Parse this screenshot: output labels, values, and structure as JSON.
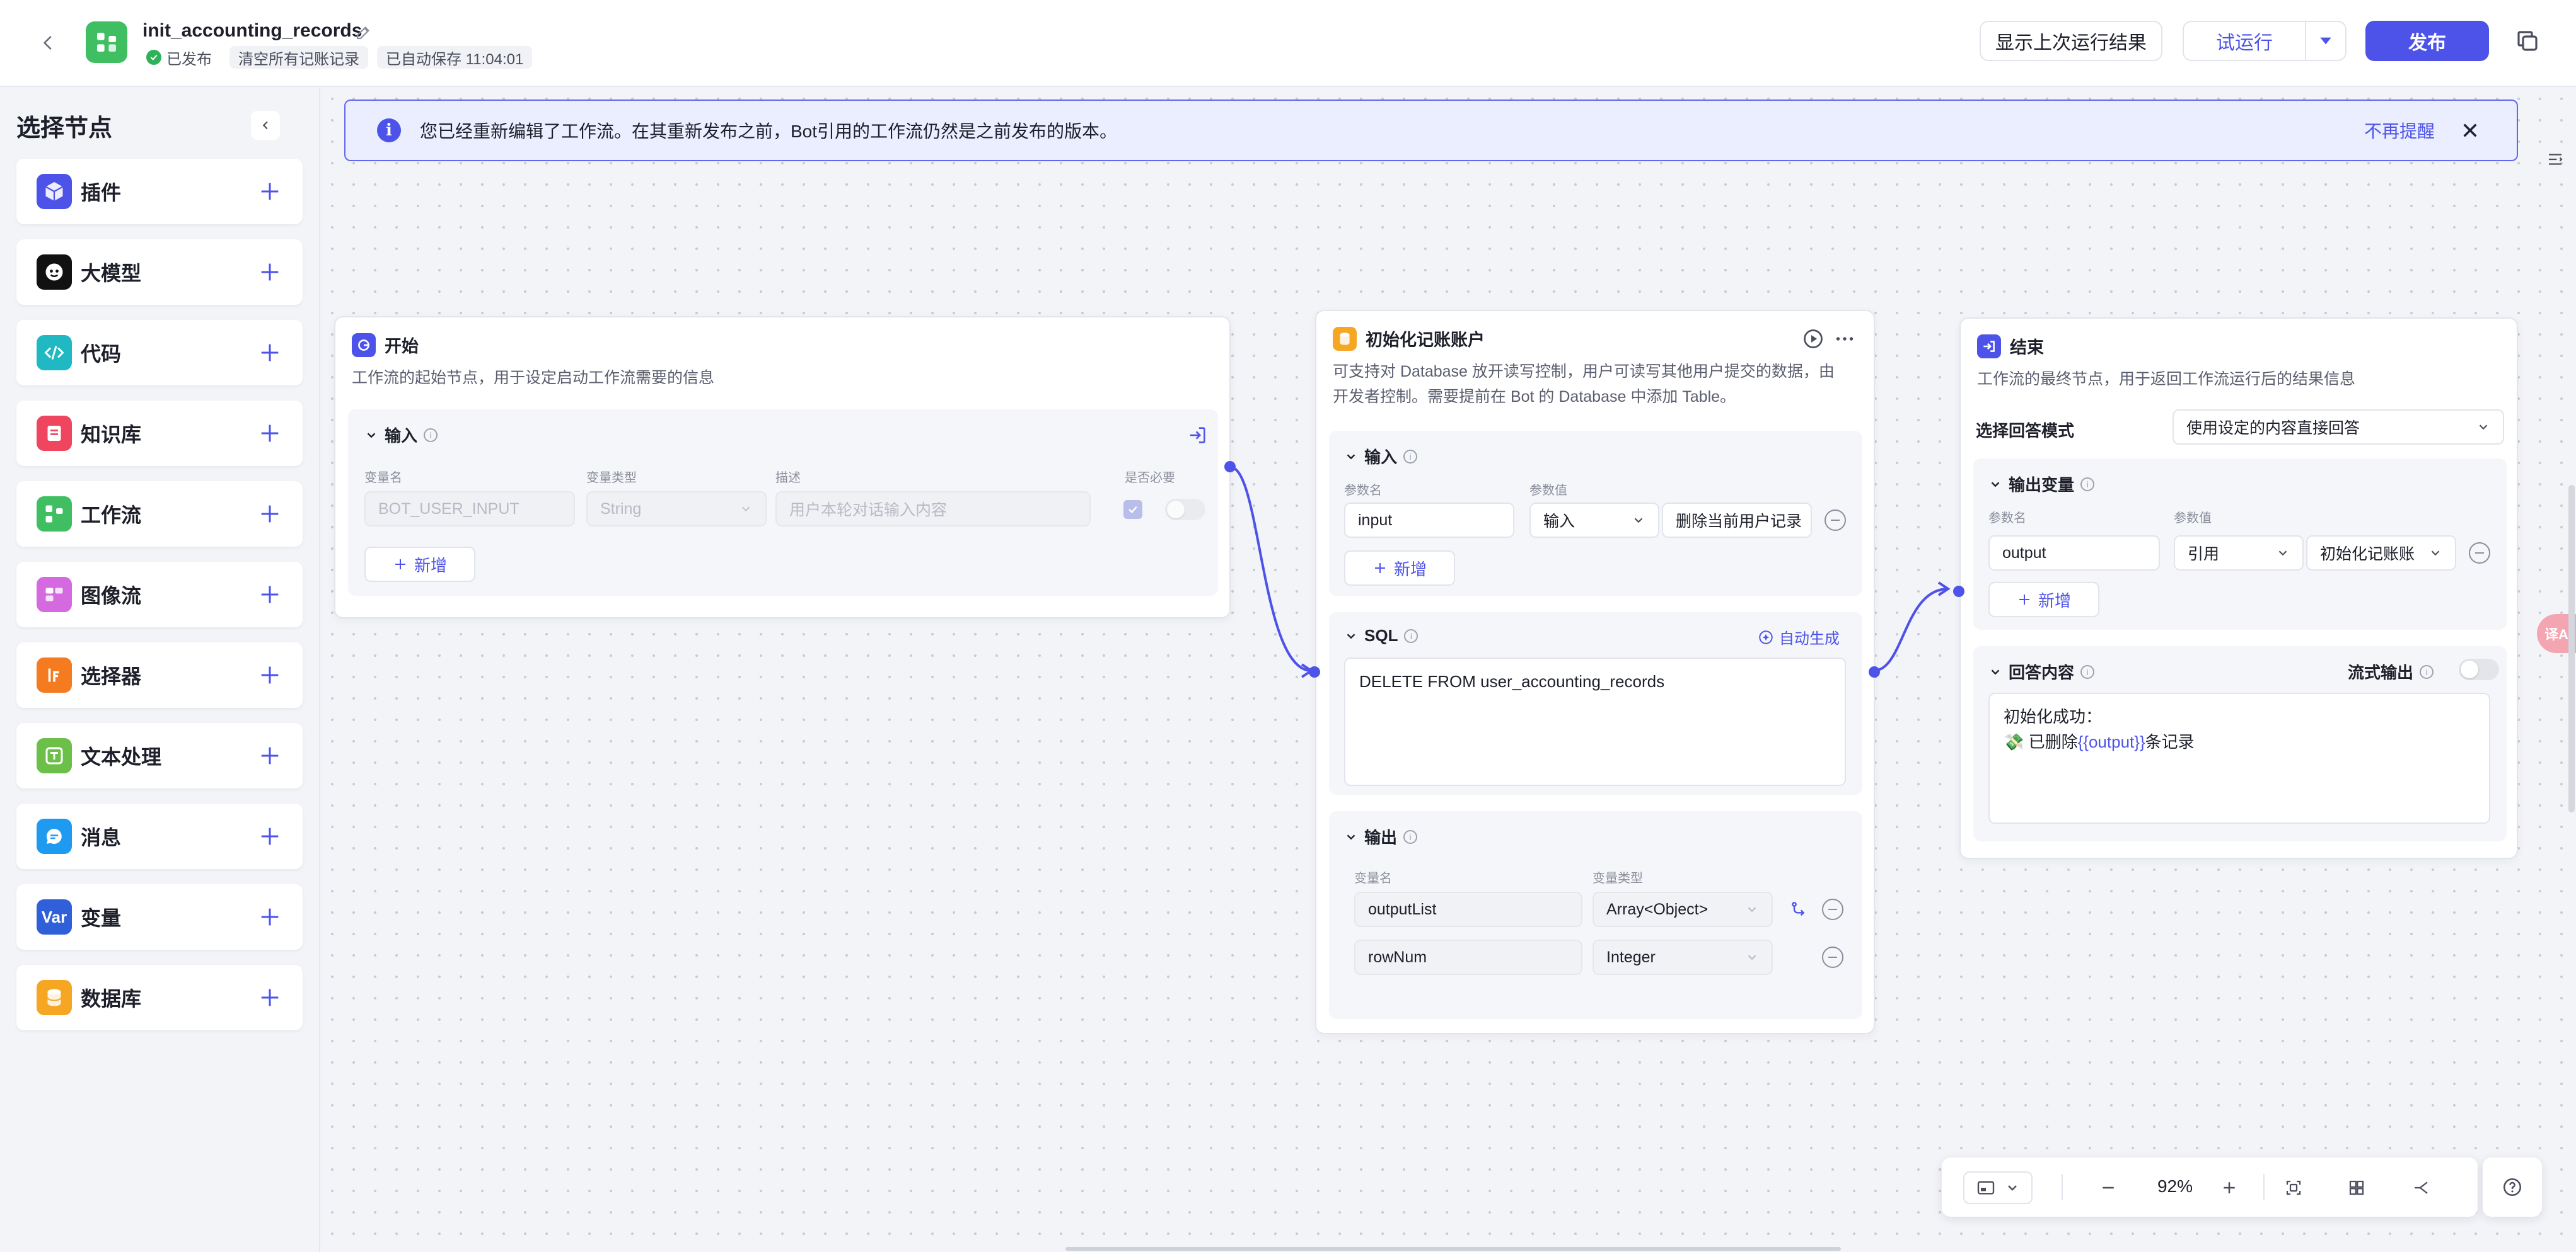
{
  "header": {
    "title": "init_accounting_records",
    "status_published": "已发布",
    "clear_records": "清空所有记账记录",
    "autosave": "已自动保存 11:04:01",
    "show_last_result": "显示上次运行结果",
    "trial_run": "试运行",
    "publish": "发布"
  },
  "sidebar": {
    "title": "选择节点",
    "items": [
      {
        "label": "插件",
        "color": "#4d53e8",
        "icon": "cube-icon"
      },
      {
        "label": "大模型",
        "color": "#111111",
        "icon": "llm-face-icon"
      },
      {
        "label": "代码",
        "color": "#20b8c2",
        "icon": "code-icon"
      },
      {
        "label": "知识库",
        "color": "#f0455e",
        "icon": "knowledge-icon"
      },
      {
        "label": "工作流",
        "color": "#3fbf62",
        "icon": "workflow-icon"
      },
      {
        "label": "图像流",
        "color": "#d469e0",
        "icon": "imageflow-icon"
      },
      {
        "label": "选择器",
        "color": "#f47b20",
        "icon": "if-icon"
      },
      {
        "label": "文本处理",
        "color": "#6cc04a",
        "icon": "text-process-icon"
      },
      {
        "label": "消息",
        "color": "#1e9bf0",
        "icon": "message-icon"
      },
      {
        "label": "变量",
        "color": "#2f5fd9",
        "icon": "variable-icon",
        "badge": "Var"
      },
      {
        "label": "数据库",
        "color": "#f5a623",
        "icon": "database-icon"
      }
    ]
  },
  "notice": {
    "message": "您已经重新编辑了工作流。在其重新发布之前，Bot引用的工作流仍然是之前发布的版本。",
    "dismiss": "不再提醒"
  },
  "start_node": {
    "title": "开始",
    "desc": "工作流的起始节点，用于设定启动工作流需要的信息",
    "input_section": "输入",
    "col_name": "变量名",
    "col_type": "变量类型",
    "col_desc": "描述",
    "col_required": "是否必要",
    "var_name": "BOT_USER_INPUT",
    "var_type": "String",
    "var_desc_placeholder": "用户本轮对话输入内容",
    "add": "新增"
  },
  "db_node": {
    "title": "初始化记账账户",
    "desc_line1": "可支持对 Database 放开读写控制，用户可读写其他用户提交的数据，由",
    "desc_line2": "开发者控制。需要提前在 Bot 的 Database 中添加 Table。",
    "input_section": "输入",
    "col_param_name": "参数名",
    "col_param_value": "参数值",
    "param_name": "input",
    "param_source": "输入",
    "param_value": "删除当前用户记录",
    "add": "新增",
    "sql_section": "SQL",
    "auto_generate": "自动生成",
    "sql": "DELETE FROM user_accounting_records",
    "output_section": "输出",
    "col_var_name": "变量名",
    "col_var_type": "变量类型",
    "outputs": [
      {
        "name": "outputList",
        "type": "Array<Object>"
      },
      {
        "name": "rowNum",
        "type": "Integer"
      }
    ]
  },
  "end_node": {
    "title": "结束",
    "desc": "工作流的最终节点，用于返回工作流运行后的结果信息",
    "answer_mode_label": "选择回答模式",
    "answer_mode_value": "使用设定的内容直接回答",
    "output_section": "输出变量",
    "col_param_name": "参数名",
    "col_param_value": "参数值",
    "param_name": "output",
    "param_source": "引用",
    "param_value": "初始化记账账",
    "add": "新增",
    "answer_section": "回答内容",
    "streaming": "流式输出",
    "answer_line1": "初始化成功：",
    "answer_line2_prefix": "💸 已删除",
    "answer_line2_var": "{{output}}",
    "answer_line2_suffix": "条记录"
  },
  "toolbar": {
    "zoom": "92%"
  },
  "translate_chip": "译A",
  "colors": {
    "accent": "#4d53e8",
    "success": "#2fb15a"
  }
}
